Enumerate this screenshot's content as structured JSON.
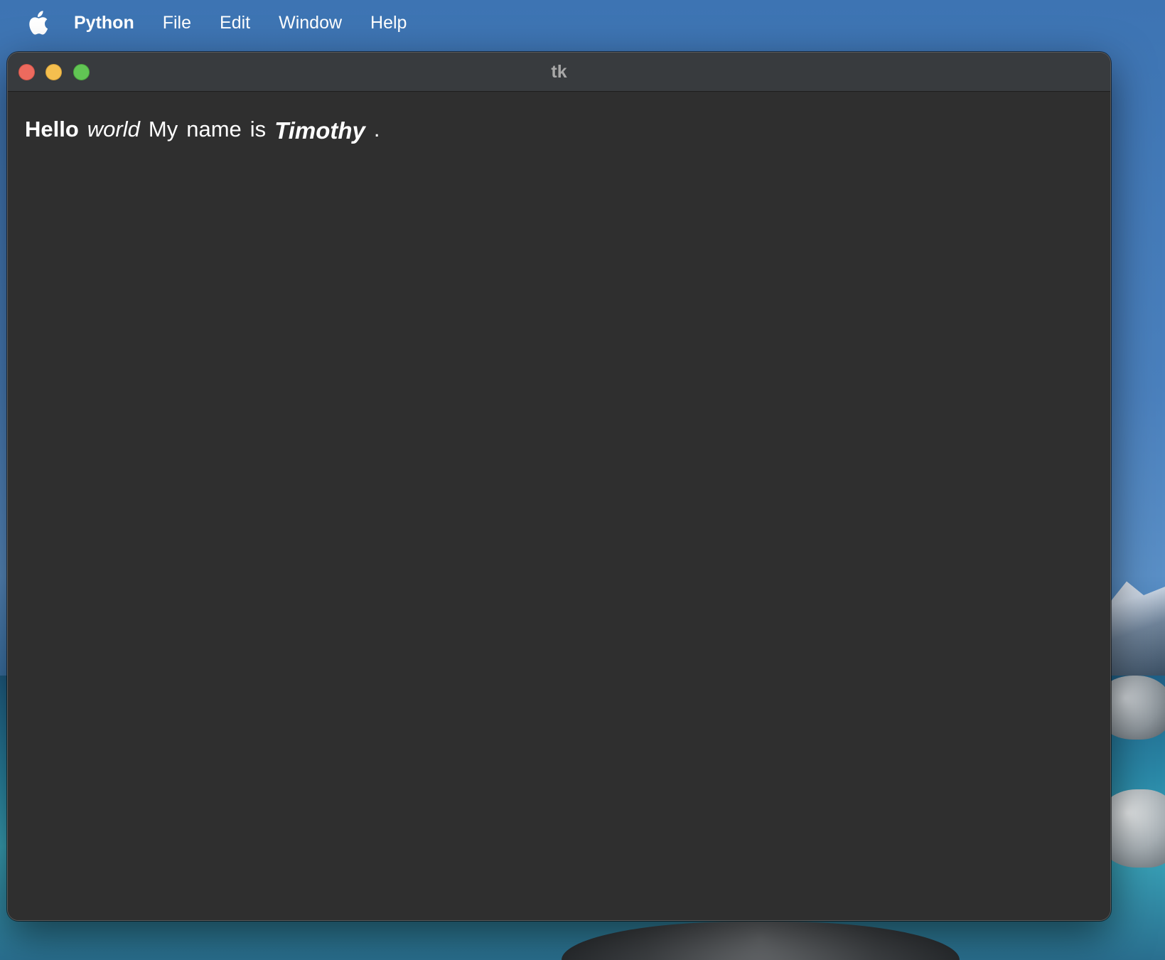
{
  "menubar": {
    "app_name": "Python",
    "items": [
      "File",
      "Edit",
      "Window",
      "Help"
    ]
  },
  "window": {
    "title": "tk",
    "words": [
      {
        "text": "Hello",
        "style": "bold"
      },
      {
        "text": "world",
        "style": "italic"
      },
      {
        "text": "My",
        "style": "normal"
      },
      {
        "text": "name",
        "style": "normal"
      },
      {
        "text": "is",
        "style": "normal"
      },
      {
        "text": "Timothy",
        "style": "bold-italic"
      },
      {
        "text": ".",
        "style": "normal"
      }
    ]
  },
  "icons": {
    "apple": "apple-logo-icon",
    "close": "close-button",
    "minimize": "minimize-button",
    "zoom": "zoom-button"
  },
  "colors": {
    "window_bg": "#2f2f2f",
    "titlebar_bg": "#383b3e",
    "close": "#ed6a5e",
    "minimize": "#f5bf4f",
    "zoom": "#61c554"
  }
}
